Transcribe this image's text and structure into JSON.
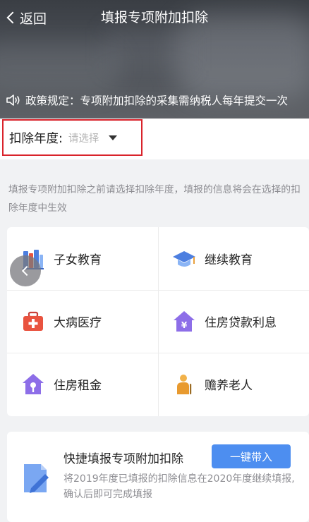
{
  "nav": {
    "back_label": "返回",
    "title": "填报专项附加扣除"
  },
  "notice": {
    "text": "政策规定：专项附加扣除的采集需纳税人每年提交一次"
  },
  "year": {
    "label": "扣除年度:",
    "placeholder": "请选择"
  },
  "hint": "填报专项附加扣除之前请选择扣除年度，填报的信息将会在选择的扣除年度中生效",
  "categories": [
    {
      "label": "子女教育",
      "icon": "books-icon"
    },
    {
      "label": "继续教育",
      "icon": "graduation-cap-icon"
    },
    {
      "label": "大病医疗",
      "icon": "medical-kit-icon"
    },
    {
      "label": "住房贷款利息",
      "icon": "house-yen-icon"
    },
    {
      "label": "住房租金",
      "icon": "house-key-icon"
    },
    {
      "label": "赡养老人",
      "icon": "elderly-person-icon"
    }
  ],
  "quick": {
    "title": "快捷填报专项附加扣除",
    "button": "一键带入",
    "desc": "将2019年度已填报的扣除信息在2020年度继续填报,确认后即可完成填报"
  },
  "colors": {
    "highlight": "#d9232b",
    "accent": "#4d8ef0",
    "hint": "#8e8e93"
  }
}
